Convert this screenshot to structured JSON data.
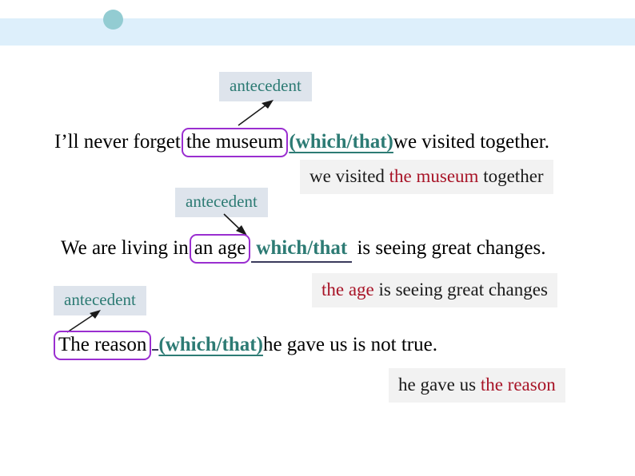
{
  "slide": {
    "header": {
      "band_color": "#ddeffb",
      "dot_color": "#93ccd2",
      "dot_name": "decorative-dot"
    },
    "accent_colors": {
      "teal": "#2d7b74",
      "purple_box": "#9a2ed0",
      "red_highlight": "#a81427",
      "callout_bg": "#dee4ec",
      "explain_bg": "#f2f2f2"
    },
    "callouts": [
      {
        "label": "antecedent"
      },
      {
        "label": "antecedent"
      },
      {
        "label": "antecedent"
      }
    ],
    "examples": [
      {
        "lead": "I’ll never forget",
        "antecedent": "the museum",
        "pronoun": "(which/that)",
        "tail": "we visited together.",
        "explanation_before": "we visited ",
        "explanation_highlight": "the museum",
        "explanation_after": " together"
      },
      {
        "lead": "We are living in",
        "antecedent": "an age",
        "pronoun": "which/that",
        "tail": "is seeing great changes.",
        "explanation_before": "",
        "explanation_highlight": "the age",
        "explanation_after": " is seeing great changes"
      },
      {
        "lead": "",
        "antecedent": "The reason",
        "pronoun": "(which/that)",
        "tail": "he gave us is not true.",
        "explanation_before": "he gave us ",
        "explanation_highlight": "the reason",
        "explanation_after": ""
      }
    ]
  }
}
